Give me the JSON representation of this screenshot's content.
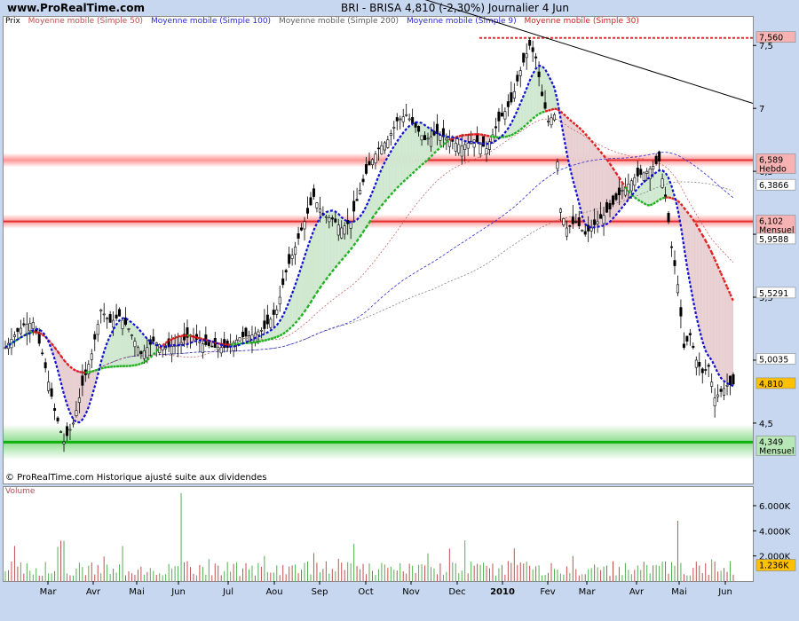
{
  "header": {
    "site": "www.ProRealTime.com",
    "title": "BRI - BRISA    4,810 (-2,30%)    Journalier  4 Jun"
  },
  "legend": [
    {
      "label": "Prix",
      "color": "#000000"
    },
    {
      "label": "Moyenne mobile (Simple 50)",
      "color": "#c05050"
    },
    {
      "label": "Moyenne mobile (Simple 100)",
      "color": "#2a2ad0"
    },
    {
      "label": "Moyenne mobile (Simple 200)",
      "color": "#606060"
    },
    {
      "label": "Moyenne mobile (Simple 9)",
      "color": "#2a2ad0"
    },
    {
      "label": "Moyenne mobile (Simple 30)",
      "color": "#d02020"
    }
  ],
  "footnote": "© ProRealTime.com  Historique ajusté suite aux dividendes",
  "volume_label": "Volume",
  "price_badges": [
    {
      "value": "7,560",
      "note": "",
      "color": "#f7b3b3"
    },
    {
      "value": "6,589",
      "note": "Hebdo",
      "color": "#f7b3b3"
    },
    {
      "value": "6,3866",
      "note": "",
      "color": "#ffffff"
    },
    {
      "value": "6,102",
      "note": "Mensuel",
      "color": "#f7b3b3"
    },
    {
      "value": "5,9588",
      "note": "",
      "color": "#ffffff"
    },
    {
      "value": "5,5291",
      "note": "",
      "color": "#ffffff"
    },
    {
      "value": "5,0035",
      "note": "",
      "color": "#ffffff"
    },
    {
      "value": "4,810",
      "note": "",
      "color": "#ffc000"
    },
    {
      "value": "4,349",
      "note": "Mensuel",
      "color": "#b7e6b7"
    }
  ],
  "volume_badge": {
    "value": "1.236K",
    "color": "#ffc000"
  },
  "chart_data": [
    {
      "type": "line",
      "name": "price",
      "y_ticks": [
        4.5,
        5,
        5.5,
        6,
        6.5,
        7,
        7.5
      ],
      "y_tick_labels": [
        "4,5",
        "5",
        "5,5",
        "6",
        "6,5",
        "7",
        "7,5"
      ],
      "ylim": [
        4.14,
        7.72
      ],
      "x_ticks": [
        "Mar",
        "Avr",
        "Mai",
        "Jun",
        "Jul",
        "Aou",
        "Sep",
        "Oct",
        "Nov",
        "Dec",
        "2010",
        "Fev",
        "Mar",
        "Avr",
        "Mai",
        "Jun"
      ],
      "close_path": [
        [
          0,
          5.1
        ],
        [
          3,
          5.2
        ],
        [
          6,
          5.28
        ],
        [
          9,
          5.3
        ],
        [
          12,
          5.05
        ],
        [
          16,
          4.6
        ],
        [
          19,
          4.35
        ],
        [
          22,
          4.5
        ],
        [
          25,
          4.8
        ],
        [
          28,
          5.05
        ],
        [
          31,
          5.4
        ],
        [
          34,
          5.3
        ],
        [
          37,
          5.35
        ],
        [
          40,
          5.25
        ],
        [
          44,
          5.05
        ],
        [
          48,
          5.15
        ],
        [
          52,
          5.1
        ],
        [
          56,
          5.12
        ],
        [
          60,
          5.2
        ],
        [
          64,
          5.13
        ],
        [
          68,
          5.1
        ],
        [
          72,
          5.1
        ],
        [
          76,
          5.18
        ],
        [
          80,
          5.2
        ],
        [
          84,
          5.25
        ],
        [
          88,
          5.4
        ],
        [
          91,
          5.7
        ],
        [
          94,
          5.9
        ],
        [
          97,
          6.1
        ],
        [
          100,
          6.3
        ],
        [
          103,
          6.15
        ],
        [
          106,
          6.12
        ],
        [
          109,
          6.05
        ],
        [
          112,
          6.1
        ],
        [
          115,
          6.35
        ],
        [
          118,
          6.55
        ],
        [
          121,
          6.68
        ],
        [
          124,
          6.75
        ],
        [
          127,
          6.9
        ],
        [
          130,
          6.95
        ],
        [
          133,
          6.85
        ],
        [
          136,
          6.75
        ],
        [
          140,
          6.8
        ],
        [
          144,
          6.75
        ],
        [
          148,
          6.7
        ],
        [
          152,
          6.75
        ],
        [
          156,
          6.68
        ],
        [
          160,
          6.9
        ],
        [
          164,
          7.05
        ],
        [
          167,
          7.3
        ],
        [
          170,
          7.5
        ],
        [
          172,
          7.4
        ],
        [
          174,
          7.1
        ],
        [
          176,
          6.9
        ],
        [
          178,
          6.95
        ],
        [
          180,
          6.2
        ],
        [
          182,
          6.05
        ],
        [
          185,
          6.1
        ],
        [
          188,
          6.0
        ],
        [
          192,
          6.1
        ],
        [
          196,
          6.2
        ],
        [
          200,
          6.35
        ],
        [
          204,
          6.45
        ],
        [
          208,
          6.5
        ],
        [
          212,
          6.58
        ],
        [
          214,
          6.3
        ],
        [
          216,
          5.9
        ],
        [
          218,
          5.6
        ],
        [
          220,
          5.1
        ],
        [
          222,
          5.2
        ],
        [
          224,
          5.0
        ],
        [
          226,
          4.9
        ],
        [
          228,
          4.95
        ],
        [
          230,
          4.7
        ],
        [
          232,
          4.75
        ],
        [
          234,
          4.8
        ],
        [
          236,
          4.81
        ]
      ],
      "x_range": [
        0,
        236
      ],
      "horizontal_levels": [
        {
          "value": 7.56,
          "label": "7,560",
          "color": "#e03030",
          "style": "dashed"
        },
        {
          "value": 6.589,
          "label": "6,589",
          "note": "Hebdo",
          "color": "#e03030",
          "style": "solid"
        },
        {
          "value": 6.102,
          "label": "6,102",
          "note": "Mensuel",
          "color": "#e03030",
          "style": "solid"
        },
        {
          "value": 4.349,
          "label": "4,349",
          "note": "Mensuel",
          "color": "#10b010",
          "style": "solid"
        }
      ],
      "ma_levels_last": {
        "simple100": 5.9588,
        "simple200": 5.5291,
        "simple50": 6.3866,
        "simple30": 5.0035
      }
    },
    {
      "type": "bar",
      "name": "volume",
      "y_ticks": [
        2000,
        4000,
        6000
      ],
      "y_tick_labels": [
        "2.000K",
        "4.000K",
        "6.000K"
      ],
      "ylim": [
        0,
        7200
      ],
      "max_spike_label": "6.000K"
    }
  ]
}
